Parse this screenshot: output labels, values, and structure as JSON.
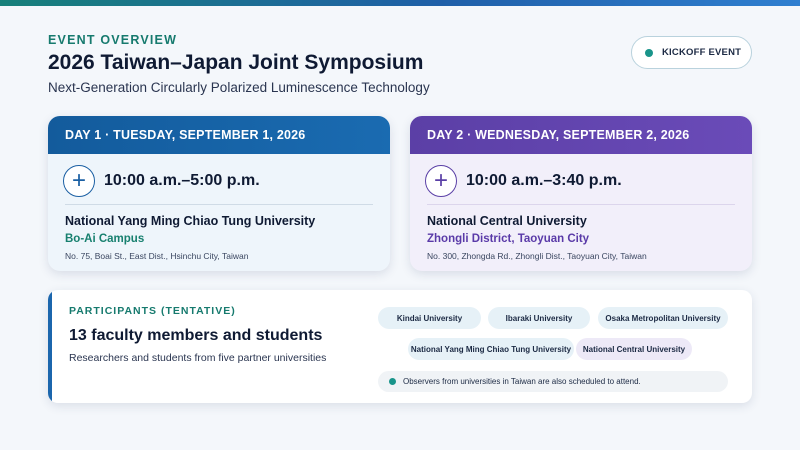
{
  "header": {
    "eyebrow": "EVENT OVERVIEW",
    "title": "2026 Taiwan–Japan Joint Symposium",
    "subtitle": "Next-Generation Circularly Polarized Luminescence Technology",
    "badge": "KICKOFF EVENT"
  },
  "days": [
    {
      "header": "DAY 1 · TUESDAY, SEPTEMBER 1, 2026",
      "time": "10:00 a.m.–5:00 p.m.",
      "venue": "National Yang Ming Chiao Tung University",
      "campus": "Bo-Ai Campus",
      "address": "No. 75, Boai St., East Dist., Hsinchu City, Taiwan"
    },
    {
      "header": "DAY 2 · WEDNESDAY, SEPTEMBER 2, 2026",
      "time": "10:00 a.m.–3:40 p.m.",
      "venue": "National Central University",
      "campus": "Zhongli District, Taoyuan City",
      "address": "No. 300, Zhongda Rd., Zhongli Dist., Taoyuan City, Taiwan"
    }
  ],
  "participants": {
    "eyebrow": "PARTICIPANTS (TENTATIVE)",
    "count": "13 faculty members and students",
    "description": "Researchers and students from five partner universities",
    "universities": [
      "Kindai University",
      "Ibaraki University",
      "Osaka Metropolitan University",
      "National Yang Ming Chiao Tung University",
      "National Central University"
    ],
    "note": "Observers from universities in Taiwan are also scheduled to attend."
  },
  "icons": {
    "time": "plus-circle-icon",
    "status_dot": "dot-icon"
  },
  "colors": {
    "accent_teal": "#167a6e",
    "day1_blue": "#135b9c",
    "day2_violet": "#5b3fa6"
  }
}
